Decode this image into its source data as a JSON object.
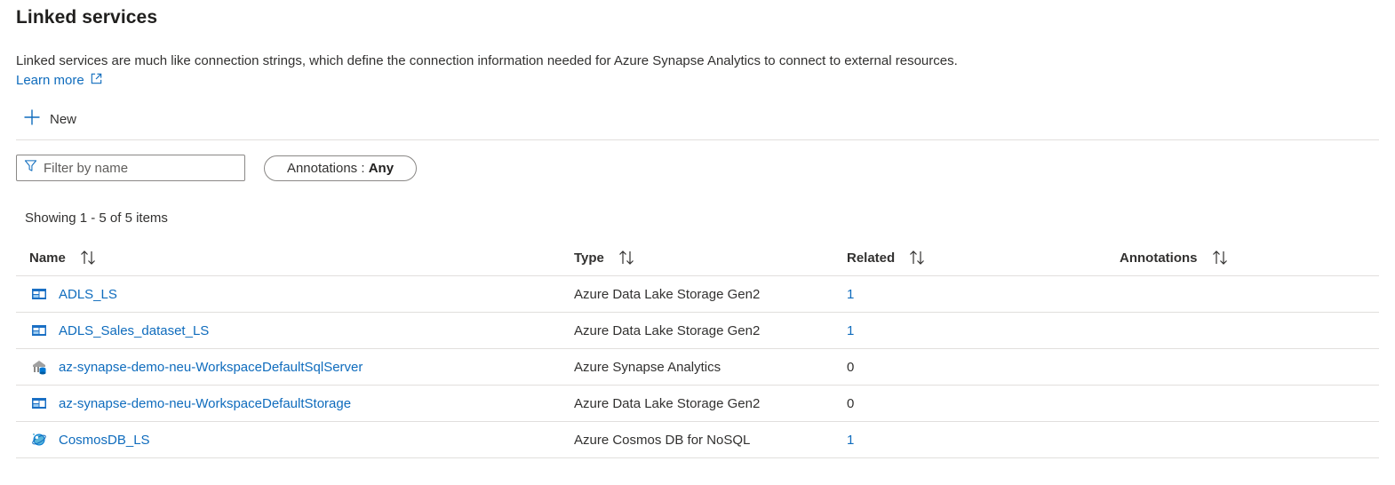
{
  "page": {
    "title": "Linked services",
    "description": "Linked services are much like connection strings, which define the connection information needed for Azure Synapse Analytics to connect to external resources.",
    "learn_more": "Learn more"
  },
  "toolbar": {
    "new_label": "New"
  },
  "filter": {
    "placeholder": "Filter by name",
    "value": ""
  },
  "annotations_filter": {
    "label": "Annotations",
    "separator": " : ",
    "value": "Any"
  },
  "showing_text": "Showing 1 - 5 of 5 items",
  "table": {
    "columns": [
      "Name",
      "Type",
      "Related",
      "Annotations"
    ],
    "rows": [
      {
        "name": "ADLS_LS",
        "icon": "storage-icon",
        "type": "Azure Data Lake Storage Gen2",
        "related": "1",
        "related_link": true,
        "annotations": ""
      },
      {
        "name": "ADLS_Sales_dataset_LS",
        "icon": "storage-icon",
        "type": "Azure Data Lake Storage Gen2",
        "related": "1",
        "related_link": true,
        "annotations": ""
      },
      {
        "name": "az-synapse-demo-neu-WorkspaceDefaultSqlServer",
        "icon": "synapse-icon",
        "type": "Azure Synapse Analytics",
        "related": "0",
        "related_link": false,
        "annotations": ""
      },
      {
        "name": "az-synapse-demo-neu-WorkspaceDefaultStorage",
        "icon": "storage-icon",
        "type": "Azure Data Lake Storage Gen2",
        "related": "0",
        "related_link": false,
        "annotations": ""
      },
      {
        "name": "CosmosDB_LS",
        "icon": "cosmos-db-icon",
        "type": "Azure Cosmos DB for NoSQL",
        "related": "1",
        "related_link": true,
        "annotations": ""
      }
    ]
  },
  "colors": {
    "link": "#0f6cbd",
    "text": "#323130",
    "border": "#e1dfdd"
  }
}
